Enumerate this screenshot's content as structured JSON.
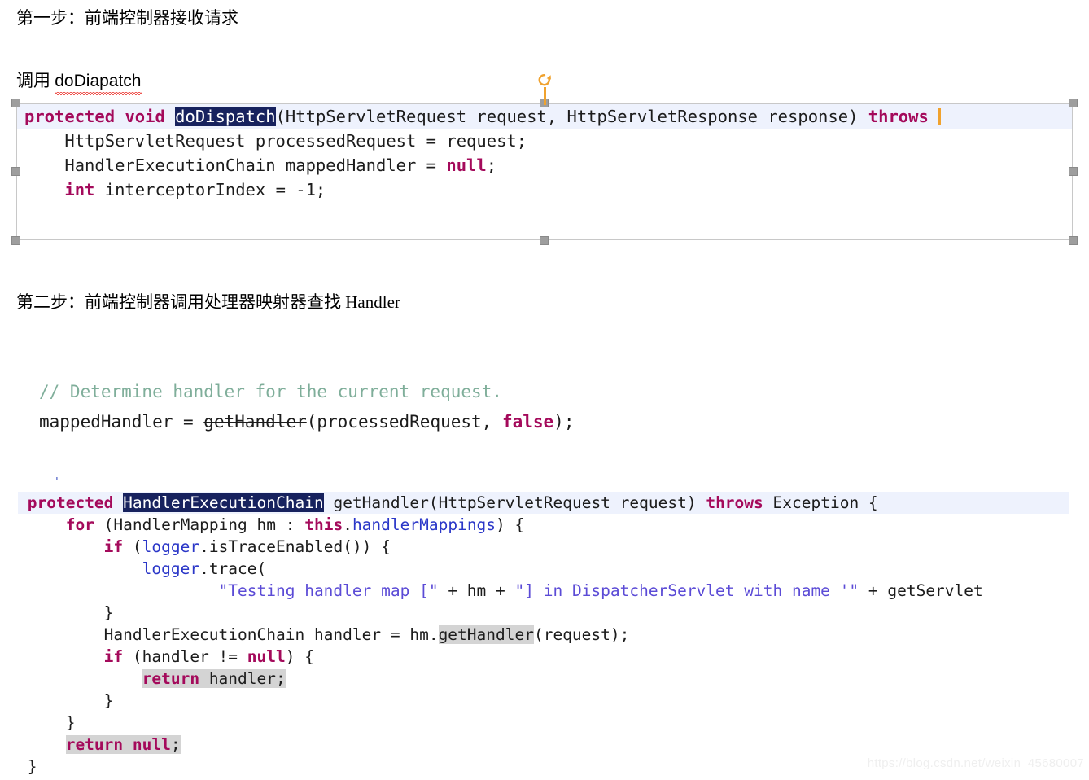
{
  "document": {
    "step1_heading": "第一步：前端控制器接收请求",
    "call_label": "调用 ",
    "call_term": "doDiapatch",
    "step2_heading": "第二步：前端控制器调用处理器映射器查找 Handler",
    "watermark": "https://blog.csdn.net/weixin_45680007"
  },
  "colors": {
    "keyword": "#a40a5b",
    "field": "#2b37c8",
    "string": "#5b4bd6",
    "comment": "#7fae9a",
    "selection_bg": "#17225e",
    "caret_line_bg": "#eef2fd",
    "occurrence_bg": "#d4d4d4",
    "handle": "#9e9e9e",
    "rotate_handle": "#f0a22e",
    "spellcheck_underline": "#e8211a",
    "watermark": "#efefef"
  },
  "code_block_1": {
    "frame_selected": true,
    "line1": {
      "kw_protected": "protected",
      "kw_void": "void",
      "selected_method": "doDispatch",
      "signature": "(HttpServletRequest request, HttpServletResponse response) ",
      "kw_throws": "throws",
      "clipped_tail": " "
    },
    "line2": "    HttpServletRequest processedRequest = request;",
    "line3_a": "    HandlerExecutionChain mappedHandler = ",
    "line3_null": "null",
    "line3_b": ";",
    "line4_kw": "int",
    "line4_rest": " interceptorIndex = -1;"
  },
  "code_block_2": {
    "comment": "// Determine handler for the current request.",
    "line2_a": "mappedHandler = ",
    "line2_strike": "getHandler",
    "line2_b": "(processedRequest, ",
    "line2_false": "false",
    "line2_c": ");"
  },
  "code_block_3": {
    "artifact": "'",
    "lines": [
      {
        "id": "signature-line",
        "highlighted": true,
        "parts": [
          {
            "t": " ",
            "c": "plain"
          },
          {
            "t": "protected",
            "c": "kw"
          },
          {
            "t": " ",
            "c": "plain"
          },
          {
            "t": "HandlerExecutionChain",
            "c": "sel"
          },
          {
            "t": " getHandler(HttpServletRequest request) ",
            "c": "plain"
          },
          {
            "t": "throws",
            "c": "kw"
          },
          {
            "t": " Exception {",
            "c": "plain"
          }
        ]
      },
      {
        "id": "for-line",
        "highlighted": false,
        "parts": [
          {
            "t": "     ",
            "c": "plain"
          },
          {
            "t": "for",
            "c": "kw"
          },
          {
            "t": " (HandlerMapping hm : ",
            "c": "plain"
          },
          {
            "t": "this",
            "c": "kw"
          },
          {
            "t": ".",
            "c": "plain"
          },
          {
            "t": "handlerMappings",
            "c": "fld"
          },
          {
            "t": ") {",
            "c": "plain"
          }
        ]
      },
      {
        "id": "if-trace-enabled",
        "highlighted": false,
        "parts": [
          {
            "t": "         ",
            "c": "plain"
          },
          {
            "t": "if",
            "c": "kw"
          },
          {
            "t": " (",
            "c": "plain"
          },
          {
            "t": "logger",
            "c": "fld"
          },
          {
            "t": ".isTraceEnabled()) {",
            "c": "plain"
          }
        ]
      },
      {
        "id": "logger-trace",
        "highlighted": false,
        "parts": [
          {
            "t": "             ",
            "c": "plain"
          },
          {
            "t": "logger",
            "c": "fld"
          },
          {
            "t": ".trace(",
            "c": "plain"
          }
        ]
      },
      {
        "id": "trace-string",
        "highlighted": false,
        "parts": [
          {
            "t": "                     ",
            "c": "plain"
          },
          {
            "t": "\"Testing handler map [\"",
            "c": "str"
          },
          {
            "t": " + hm + ",
            "c": "plain"
          },
          {
            "t": "\"] in DispatcherServlet with name '\"",
            "c": "str"
          },
          {
            "t": " + getServlet",
            "c": "plain"
          }
        ]
      },
      {
        "id": "close-if-trace",
        "highlighted": false,
        "parts": [
          {
            "t": "         }",
            "c": "plain"
          }
        ]
      },
      {
        "id": "handler-assign",
        "highlighted": false,
        "parts": [
          {
            "t": "         HandlerExecutionChain handler = hm.",
            "c": "plain"
          },
          {
            "t": "getHandler",
            "c": "occ"
          },
          {
            "t": "(request);",
            "c": "plain"
          }
        ]
      },
      {
        "id": "if-handler-not-null",
        "highlighted": false,
        "parts": [
          {
            "t": "         ",
            "c": "plain"
          },
          {
            "t": "if",
            "c": "kw"
          },
          {
            "t": " (handler != ",
            "c": "plain"
          },
          {
            "t": "null",
            "c": "kw"
          },
          {
            "t": ") {",
            "c": "plain"
          }
        ]
      },
      {
        "id": "return-handler",
        "highlighted": false,
        "parts": [
          {
            "t": "             ",
            "c": "plain"
          },
          {
            "t": "return",
            "c": "kw occ"
          },
          {
            "t": " handler;",
            "c": "occ"
          }
        ]
      },
      {
        "id": "close-if-handler",
        "highlighted": false,
        "parts": [
          {
            "t": "         }",
            "c": "plain"
          }
        ]
      },
      {
        "id": "close-for",
        "highlighted": false,
        "parts": [
          {
            "t": "     }",
            "c": "plain"
          }
        ]
      },
      {
        "id": "return-null",
        "highlighted": false,
        "parts": [
          {
            "t": "     ",
            "c": "plain"
          },
          {
            "t": "return",
            "c": "kw occ"
          },
          {
            "t": " ",
            "c": "occ"
          },
          {
            "t": "null",
            "c": "kw occ"
          },
          {
            "t": ";",
            "c": "occ"
          }
        ]
      },
      {
        "id": "close-method",
        "highlighted": false,
        "parts": [
          {
            "t": " }",
            "c": "plain"
          }
        ]
      }
    ]
  }
}
